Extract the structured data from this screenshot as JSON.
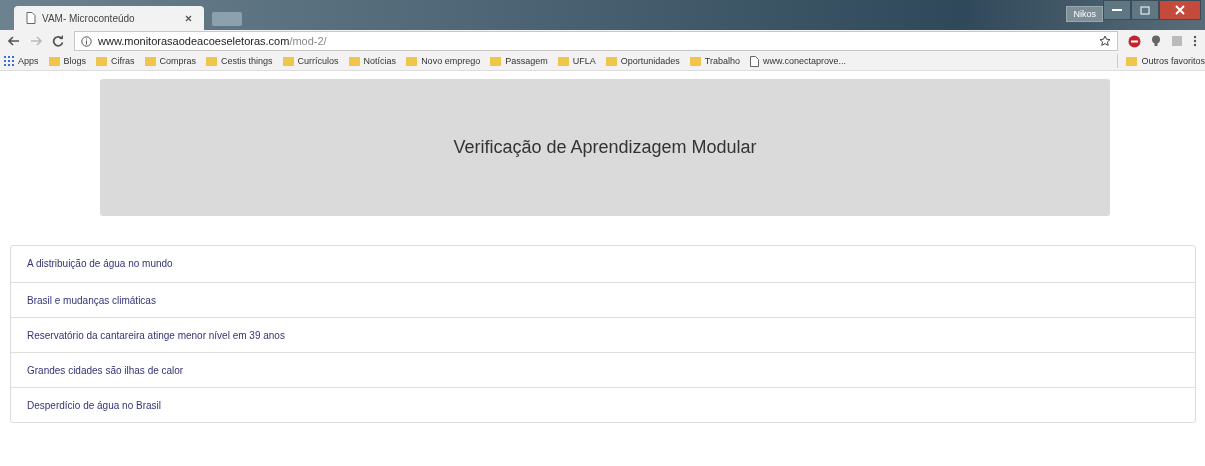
{
  "window": {
    "tab_title": "VAM- Microconteúdo",
    "user": "Nikos"
  },
  "address_bar": {
    "domain": "www.monitorasaodeacoeseletoras.com",
    "path": "/mod-2/"
  },
  "bookmarks": [
    {
      "label": "Apps",
      "kind": "apps"
    },
    {
      "label": "Blogs",
      "kind": "folder"
    },
    {
      "label": "Cifras",
      "kind": "folder"
    },
    {
      "label": "Compras",
      "kind": "folder"
    },
    {
      "label": "Cestis things",
      "kind": "folder"
    },
    {
      "label": "Currículos",
      "kind": "folder"
    },
    {
      "label": "Notícias",
      "kind": "folder"
    },
    {
      "label": "Novo emprego",
      "kind": "folder"
    },
    {
      "label": "Passagem",
      "kind": "folder"
    },
    {
      "label": "UFLA",
      "kind": "folder"
    },
    {
      "label": "Oportunidades",
      "kind": "folder"
    },
    {
      "label": "Trabalho",
      "kind": "folder"
    },
    {
      "label": "www.conectaprove...",
      "kind": "page"
    }
  ],
  "other_bookmarks": "Outros favoritos",
  "header": {
    "title": "Verificação de Aprendizagem Modular"
  },
  "topics": [
    "A distribuição de água no mundo",
    "Brasil e mudanças climáticas",
    "Reservatório da cantareira atinge menor nível em 39 anos",
    "Grandes cidades são ilhas de calor",
    "Desperdício de água no Brasil"
  ]
}
